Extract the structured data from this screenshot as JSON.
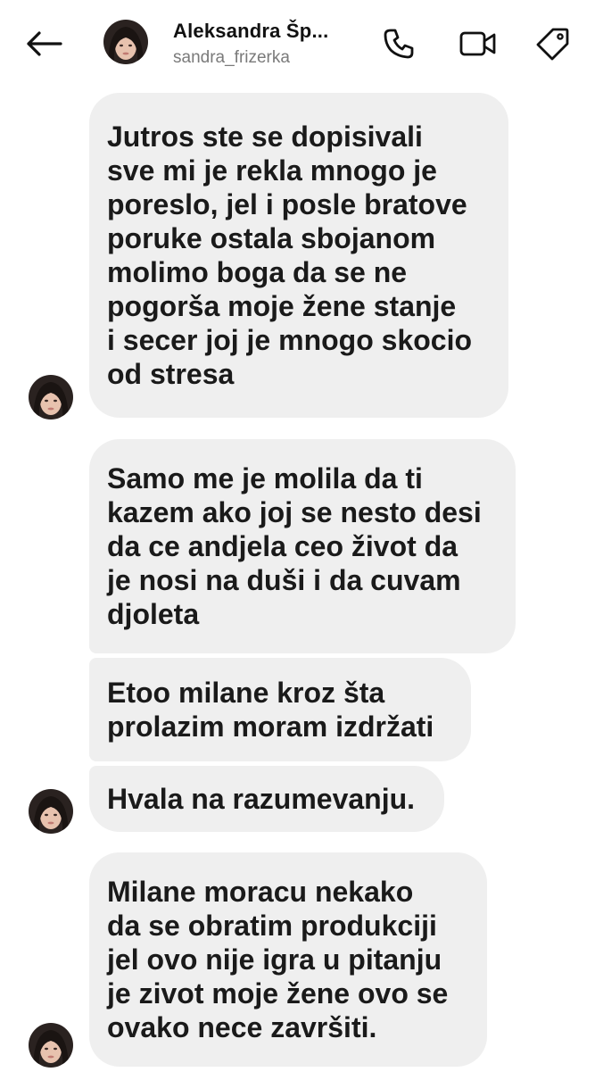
{
  "header": {
    "back_icon": "arrow-left-icon",
    "name": "Aleksandra Šp...",
    "username": "sandra_frizerka",
    "actions": [
      {
        "icon": "phone-icon"
      },
      {
        "icon": "video-camera-icon"
      },
      {
        "icon": "tag-icon"
      }
    ]
  },
  "colors": {
    "bubble_bg": "#efefef",
    "text": "#1a1a1a",
    "username": "#7a7a7a"
  },
  "messages": [
    {
      "lines": [
        "Jutros ste se dopisivali",
        "sve mi je rekla mnogo je",
        "poreslo, jel i posle bratove",
        "poruke ostala sbojanom",
        "molimo boga da se ne",
        "pogorša moje žene stanje",
        "i secer joj je mnogo skocio",
        "od stresa"
      ]
    },
    {
      "lines": [
        "Samo me je molila da ti",
        "kazem ako joj se nesto desi",
        "da ce andjela ceo život da",
        "je nosi na duši i da cuvam",
        "djoleta"
      ]
    },
    {
      "lines": [
        "Etoo milane kroz šta",
        "prolazim moram izdržati"
      ]
    },
    {
      "lines": [
        "Hvala na razumevanju."
      ]
    },
    {
      "lines": [
        "Milane moracu nekako",
        "da se obratim produkciji",
        "jel ovo nije igra u pitanju",
        "je zivot moje žene ovo se",
        "ovako nece završiti."
      ]
    }
  ]
}
